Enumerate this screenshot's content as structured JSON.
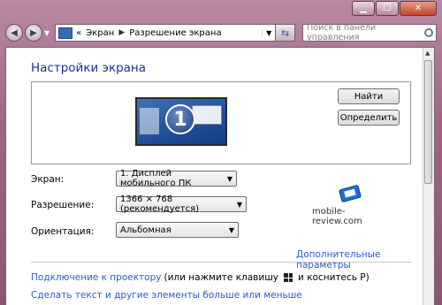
{
  "titlebar": {
    "minimize_icon": "minimize-icon",
    "maximize_icon": "maximize-icon",
    "close_icon": "close-icon"
  },
  "nav": {
    "back_icon": "back-arrow-icon",
    "forward_icon": "forward-arrow-icon",
    "breadcrumb_prefix": "«",
    "breadcrumb": [
      "Экран",
      "Разрешение экрана"
    ],
    "search_placeholder": "Поиск в панели управления"
  },
  "page": {
    "title": "Настройки экрана",
    "monitor_number": "1",
    "find_button": "Найти",
    "identify_button": "Определить"
  },
  "fields": {
    "screen_label": "Экран:",
    "screen_value": "1. Дисплей мобильного ПК",
    "resolution_label": "Разрешение:",
    "resolution_value": "1366 × 768 (рекомендуется)",
    "orientation_label": "Ориентация:",
    "orientation_value": "Альбомная"
  },
  "links": {
    "advanced": "Дополнительные параметры",
    "projector_link": "Подключение к проектору",
    "projector_text_before": "(или нажмите клавишу",
    "projector_text_after": "и коснитесь P)",
    "text_size": "Сделать текст и другие элементы больше или меньше"
  },
  "watermark": {
    "text": "mobile-review.com"
  },
  "colors": {
    "title": "#1e3287",
    "link": "#2a5ad2",
    "frame": "#9e6684"
  }
}
